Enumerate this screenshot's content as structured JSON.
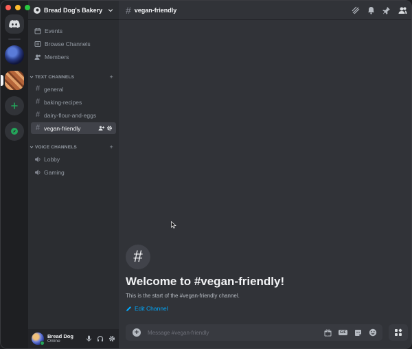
{
  "window": {
    "controls": [
      "close",
      "minimize",
      "zoom"
    ]
  },
  "rail": {
    "items": [
      {
        "name": "home",
        "icon": "discord-logo-icon"
      },
      {
        "name": "server-1",
        "icon": "server-avatar"
      },
      {
        "name": "server-2",
        "icon": "server-avatar",
        "selected": true
      },
      {
        "name": "add-server",
        "icon": "plus-icon"
      },
      {
        "name": "explore",
        "icon": "compass-icon"
      }
    ]
  },
  "sidebar": {
    "guild_name": "Bread Dog's Bakery",
    "nav": [
      {
        "label": "Events",
        "icon": "calendar-icon"
      },
      {
        "label": "Browse Channels",
        "icon": "browse-icon"
      },
      {
        "label": "Members",
        "icon": "members-icon"
      }
    ],
    "text_category": "TEXT CHANNELS",
    "text_channels": [
      {
        "label": "general"
      },
      {
        "label": "baking-recipes"
      },
      {
        "label": "dairy-flour-and-eggs"
      },
      {
        "label": "vegan-friendly",
        "active": true
      }
    ],
    "voice_category": "VOICE CHANNELS",
    "voice_channels": [
      {
        "label": "Lobby"
      },
      {
        "label": "Gaming"
      }
    ]
  },
  "user": {
    "name": "Bread Dog",
    "status": "Online",
    "status_color": "#23a55a"
  },
  "header": {
    "channel_name": "vegan-friendly"
  },
  "welcome": {
    "hash": "#",
    "title": "Welcome to #vegan-friendly!",
    "subtitle": "This is the start of the #vegan-friendly channel.",
    "edit_label": "Edit Channel"
  },
  "composer": {
    "placeholder": "Message #vegan-friendly",
    "gif_label": "GIF"
  },
  "colors": {
    "accent_link": "#00a8fc",
    "background": "#313338",
    "sidebar": "#2b2d31",
    "active_channel": "#404249"
  }
}
